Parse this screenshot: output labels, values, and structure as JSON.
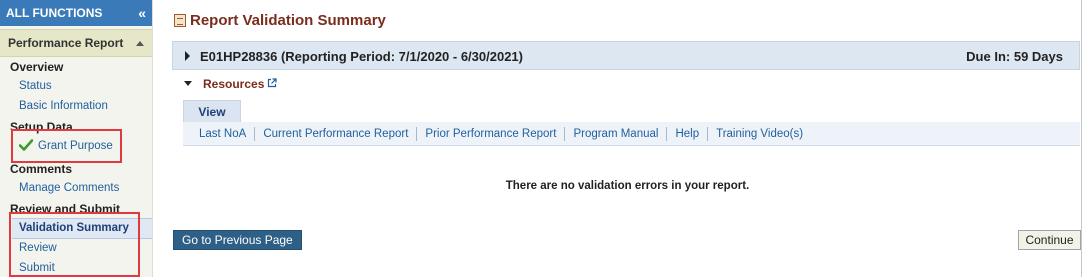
{
  "sidebar": {
    "header": "ALL FUNCTIONS",
    "collapse_glyph": "«",
    "section": "Performance Report",
    "groups": {
      "overview": "Overview",
      "setup_data": "Setup Data",
      "comments": "Comments",
      "review_submit": "Review and Submit"
    },
    "items": {
      "status": "Status",
      "basic_information": "Basic Information",
      "grant_purpose": "Grant Purpose",
      "manage_comments": "Manage Comments",
      "validation_summary": "Validation Summary",
      "review": "Review",
      "submit": "Submit"
    },
    "highlight_color": "#e0393e",
    "check_icon": "green-check-icon"
  },
  "main": {
    "title": "Report Validation Summary",
    "grant": {
      "title": "E01HP28836 (Reporting Period: 7/1/2020 - 6/30/2021)",
      "due_in": "Due In: 59 Days"
    },
    "resources": {
      "label": "Resources",
      "tab": "View",
      "links": [
        "Last NoA",
        "Current Performance Report",
        "Prior Performance Report",
        "Program Manual",
        "Help",
        "Training Video(s)"
      ]
    },
    "message": "There are no validation errors in your report.",
    "buttons": {
      "previous": "Go to Previous Page",
      "continue": "Continue"
    }
  }
}
